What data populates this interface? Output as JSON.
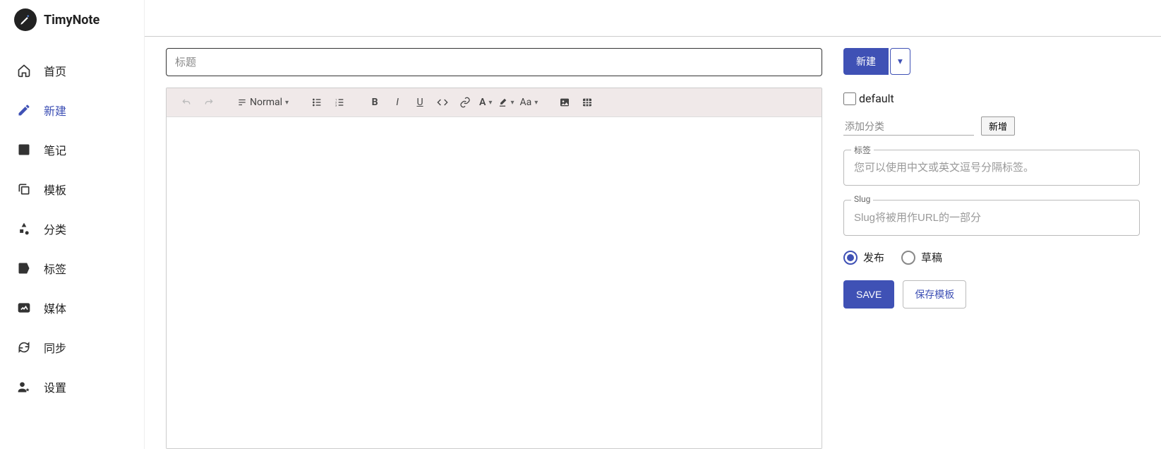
{
  "app": {
    "name": "TimyNote"
  },
  "sidebar": {
    "items": [
      {
        "label": "首页",
        "icon": "home"
      },
      {
        "label": "新建",
        "icon": "edit",
        "active": true
      },
      {
        "label": "笔记",
        "icon": "note"
      },
      {
        "label": "模板",
        "icon": "copy"
      },
      {
        "label": "分类",
        "icon": "category"
      },
      {
        "label": "标签",
        "icon": "tag"
      },
      {
        "label": "媒体",
        "icon": "media"
      },
      {
        "label": "同步",
        "icon": "sync"
      },
      {
        "label": "设置",
        "icon": "settings"
      }
    ]
  },
  "editor": {
    "title_placeholder": "标题",
    "format_label": "Normal",
    "font_label": "Aa"
  },
  "panel": {
    "new_button": "新建",
    "default_checkbox": "default",
    "category_placeholder": "添加分类",
    "category_add": "新增",
    "tags_label": "标签",
    "tags_placeholder": "您可以使用中文或英文逗号分隔标签。",
    "slug_label": "Slug",
    "slug_placeholder": "Slug将被用作URL的一部分",
    "publish_label": "发布",
    "draft_label": "草稿",
    "save_button": "SAVE",
    "save_template_button": "保存模板"
  }
}
